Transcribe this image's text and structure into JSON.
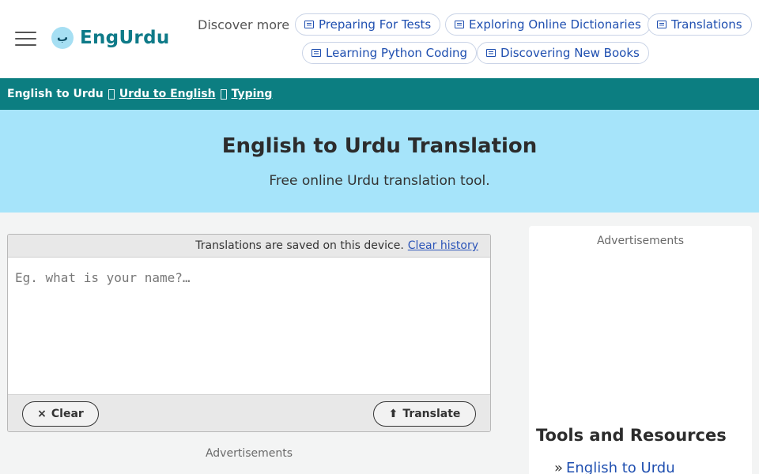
{
  "header": {
    "logo_glyph": "ب",
    "logo_text": "EngUrdu",
    "discover_label": "Discover more",
    "pills": [
      {
        "label": "Preparing For Tests",
        "icon": "news-icon"
      },
      {
        "label": "Exploring Online Dictionaries",
        "icon": "news-icon"
      },
      {
        "label": "Translations",
        "icon": "news-icon"
      },
      {
        "label": "Learning Python Coding",
        "icon": "news-icon"
      },
      {
        "label": "Discovering New Books",
        "icon": "news-icon"
      }
    ]
  },
  "navbar": {
    "items": [
      {
        "label": "English to Urdu"
      },
      {
        "label": "Urdu to English"
      },
      {
        "label": "Typing"
      }
    ]
  },
  "hero": {
    "title": "English to Urdu Translation",
    "subtitle": "Free online Urdu translation tool."
  },
  "translator": {
    "saved_notice": "Translations are saved on this device.",
    "clear_history_label": "Clear history",
    "input_placeholder": "Eg. what is your name?…",
    "input_value": "",
    "clear_label": "Clear",
    "clear_icon": "×",
    "translate_label": "Translate",
    "translate_icon": "⬆"
  },
  "ads": {
    "left_label": "Advertisements",
    "right_label": "Advertisements"
  },
  "sidebar": {
    "tools_title": "Tools and Resources",
    "items": [
      {
        "bullet": "»",
        "label": "English to Urdu"
      }
    ]
  },
  "colors": {
    "navbar_bg": "#0c7e81",
    "hero_bg": "#a6e4fa",
    "link_blue": "#1f4fb0",
    "logo_teal": "#0e7a88"
  }
}
